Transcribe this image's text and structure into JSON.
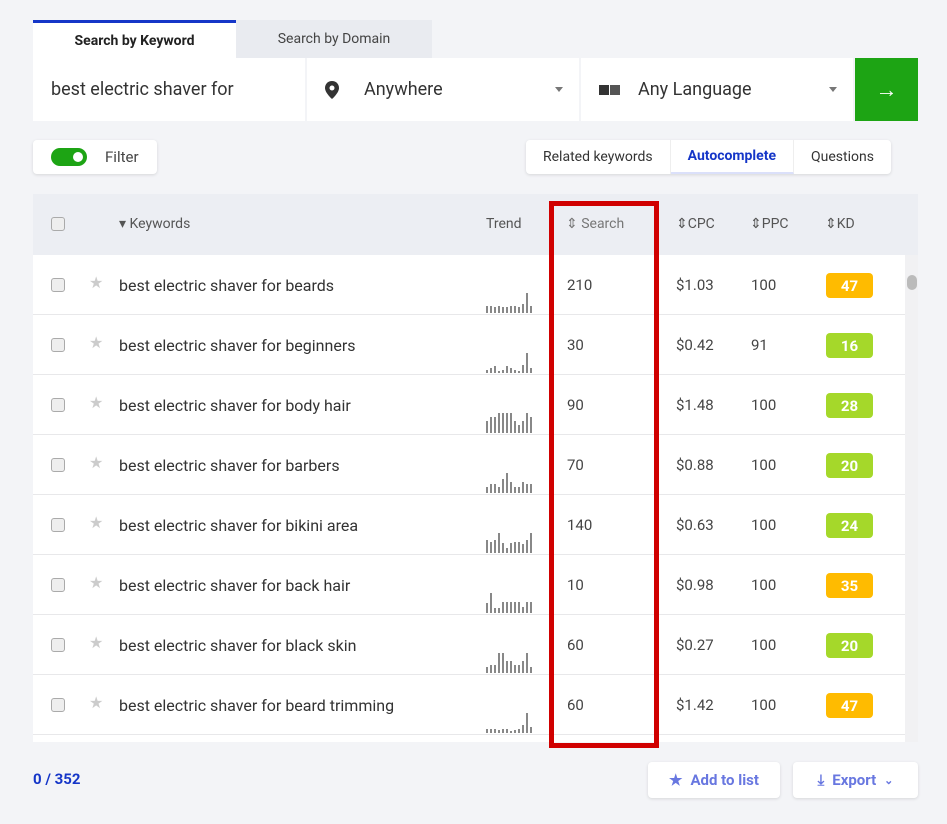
{
  "tabs": [
    "Search by Keyword",
    "Search by Domain"
  ],
  "search": {
    "keyword": "best electric shaver for",
    "location": "Anywhere",
    "language": "Any Language",
    "go_icon": "arrow-right-icon"
  },
  "filter": {
    "label": "Filter",
    "on": true
  },
  "modes": [
    "Related keywords",
    "Autocomplete",
    "Questions"
  ],
  "active_mode": "Autocomplete",
  "columns": {
    "keywords": "Keywords",
    "trend": "Trend",
    "search": "Search",
    "cpc": "CPC",
    "ppc": "PPC",
    "kd": "KD"
  },
  "colors": {
    "accent": "#1536c8",
    "go": "#1da414",
    "kd_high": "#ffbb00",
    "kd_low": "#a5d82a",
    "highlight": "#d00000"
  },
  "rows": [
    {
      "keyword": "best electric shaver for beards",
      "search": "210",
      "cpc": "$1.03",
      "ppc": "100",
      "kd": "47",
      "trend": [
        35,
        35,
        28,
        35,
        28,
        28,
        35,
        35,
        28,
        45,
        100,
        35
      ]
    },
    {
      "keyword": "best electric shaver for beginners",
      "search": "30",
      "cpc": "$0.42",
      "ppc": "91",
      "kd": "16",
      "trend": [
        15,
        25,
        35,
        12,
        15,
        35,
        25,
        15,
        12,
        40,
        100,
        25
      ]
    },
    {
      "keyword": "best electric shaver for body hair",
      "search": "90",
      "cpc": "$1.48",
      "ppc": "100",
      "kd": "28",
      "trend": [
        60,
        80,
        80,
        100,
        100,
        100,
        100,
        60,
        40,
        60,
        100,
        80
      ]
    },
    {
      "keyword": "best electric shaver for barbers",
      "search": "70",
      "cpc": "$0.88",
      "ppc": "100",
      "kd": "20",
      "trend": [
        30,
        45,
        45,
        30,
        70,
        100,
        55,
        30,
        30,
        55,
        45,
        45
      ]
    },
    {
      "keyword": "best electric shaver for bikini area",
      "search": "140",
      "cpc": "$0.63",
      "ppc": "100",
      "kd": "24",
      "trend": [
        65,
        55,
        65,
        100,
        50,
        25,
        50,
        55,
        55,
        45,
        65,
        100
      ]
    },
    {
      "keyword": "best electric shaver for back hair",
      "search": "10",
      "cpc": "$0.98",
      "ppc": "100",
      "kd": "35",
      "trend": [
        50,
        100,
        25,
        25,
        55,
        55,
        55,
        55,
        55,
        30,
        55,
        55
      ]
    },
    {
      "keyword": "best electric shaver for black skin",
      "search": "60",
      "cpc": "$0.27",
      "ppc": "100",
      "kd": "20",
      "trend": [
        30,
        40,
        40,
        100,
        100,
        60,
        60,
        40,
        40,
        60,
        100,
        30
      ]
    },
    {
      "keyword": "best electric shaver for beard trimming",
      "search": "60",
      "cpc": "$1.42",
      "ppc": "100",
      "kd": "47",
      "trend": [
        20,
        20,
        20,
        15,
        20,
        20,
        12,
        15,
        20,
        40,
        100,
        30
      ]
    }
  ],
  "footer": {
    "count": "0 / 352",
    "add_to_list": "Add to list",
    "export": "Export"
  }
}
